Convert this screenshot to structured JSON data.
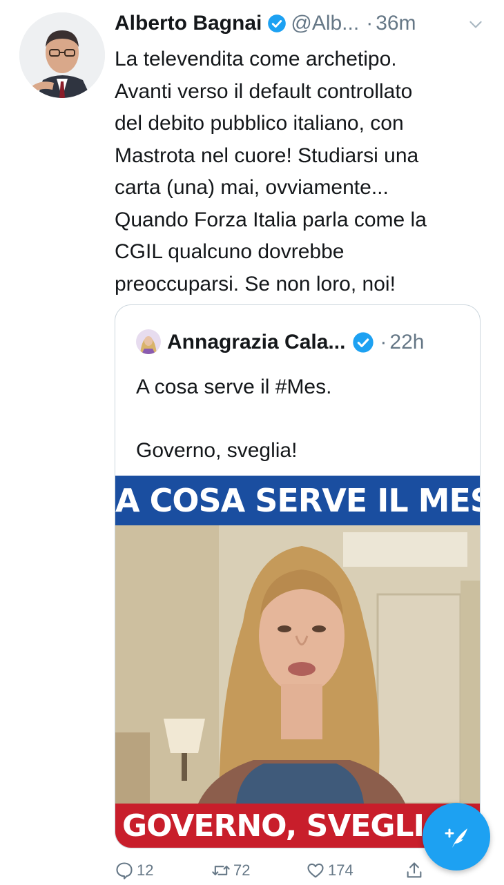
{
  "tweet": {
    "author_name": "Alberto Bagnai",
    "handle": "@Alb...",
    "separator": "·",
    "time": "36m",
    "verified": true,
    "text_lines": [
      "La televendita come archetipo.",
      "Avanti verso il default controllato",
      "del debito pubblico italiano, con",
      "Mastrota nel cuore! Studiarsi una",
      "carta (una) mai, ovviamente...",
      "Quando Forza Italia parla come la",
      "CGIL qualcuno dovrebbe",
      "preoccuparsi. Se non loro, noi!"
    ]
  },
  "quoted_tweet": {
    "author_name": "Annagrazia Cala...",
    "verified": true,
    "separator": "·",
    "time": "22h",
    "text": "A cosa serve il #Mes.\n\nGoverno, sveglia!",
    "media": {
      "banner_top": "A COSA SERVE IL MES",
      "banner_bottom": "GOVERNO, SVEGLIA"
    }
  },
  "actions": {
    "reply_count": "12",
    "retweet_count": "72",
    "like_count": "174",
    "share_icon": "share-icon"
  },
  "colors": {
    "accent": "#1da1f2",
    "secondary_text": "#657786",
    "banner_blue": "#1a4ea0",
    "banner_red": "#c81e2b"
  }
}
